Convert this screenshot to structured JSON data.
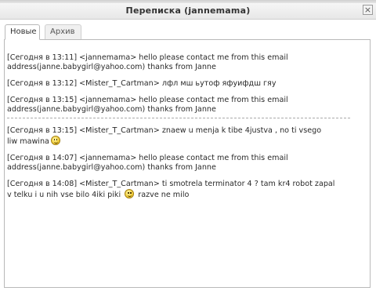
{
  "window": {
    "title": "Переписка (jannemama)",
    "close_label": "×"
  },
  "tabs": [
    {
      "label": "Новые",
      "active": true
    },
    {
      "label": "Архив",
      "active": false
    }
  ],
  "messages": [
    {
      "line1": "[Сегодня в 13:11] <jannemama> hello please contact me from this email",
      "line2": "address(janne.babygirl@yahoo.com) thanks from Janne"
    },
    {
      "line1": "[Сегодня в 13:12] <Mister_T_Cartman> лфл мш ьутоф яфуифдш гяу"
    },
    {
      "line1": "[Сегодня в 13:15] <jannemama> hello please contact me from this email",
      "line2": "address(janne.babygirl@yahoo.com) thanks from Janne"
    },
    {
      "line1": "[Сегодня в 13:15] <Mister_T_Cartman> znaew u menja k tibe 4justva , no ti  vsego",
      "line2": "liw mawina",
      "emoticon": "wink-smiley"
    },
    {
      "line1": "[Сегодня в 14:07] <jannemama> hello please contact me from this email",
      "line2": "address(janne.babygirl@yahoo.com) thanks from Janne"
    },
    {
      "line1": "[Сегодня в 14:08] <Mister_T_Cartman> ti smotrela terminator 4 ? tam kr4 robot zapal",
      "line2a": "v telku i u nih vse bilo 4iki piki",
      "line2b": "razve ne milo",
      "emoticon": "smile-smiley"
    }
  ],
  "colors": {
    "border": "#b9b9b9",
    "text": "#2a2a2a",
    "titlebar": "#efefef"
  }
}
